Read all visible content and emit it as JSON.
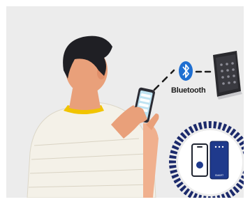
{
  "illustration": {
    "bluetooth_label": "Bluetooth",
    "badge_text": "SMART",
    "colors": {
      "background": "#ececec",
      "bluetooth_blue": "#1f6fd1",
      "badge_ring": "#1c2a6b",
      "hair": "#1f1f24",
      "skin": "#e9a07a",
      "shirt": "#f4f1e8",
      "collar": "#f1c400",
      "reader_body": "#2a2a2e"
    },
    "icons": [
      "bluetooth-icon",
      "keypad-icon",
      "phone-icon",
      "card-icon"
    ]
  }
}
